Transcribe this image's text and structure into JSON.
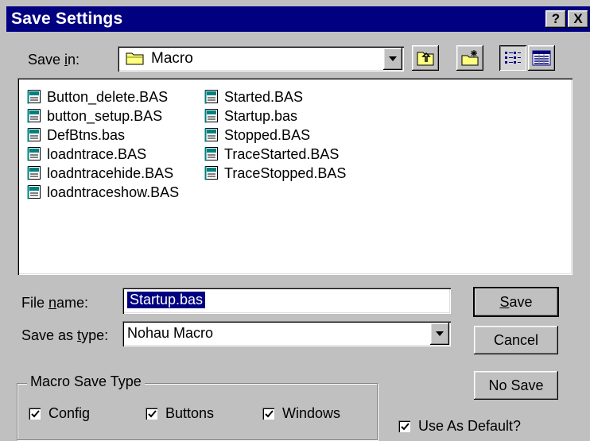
{
  "dialog": {
    "title": "Save Settings",
    "help_glyph": "?",
    "close_glyph": "X"
  },
  "save_in": {
    "label_pre": "Save ",
    "label_key": "i",
    "label_post": "n:",
    "value": "Macro"
  },
  "toolbar": {
    "icons": [
      "up-one-level-icon",
      "create-new-folder-icon",
      "list-view-icon",
      "details-view-icon"
    ]
  },
  "files": {
    "column_1": [
      "Button_delete.BAS",
      "button_setup.BAS",
      "DefBtns.bas",
      "loadntrace.BAS",
      "loadntracehide.BAS",
      "loadntraceshow.BAS"
    ],
    "column_2": [
      "Started.BAS",
      "Startup.bas",
      "Stopped.BAS",
      "TraceStarted.BAS",
      "TraceStopped.BAS"
    ]
  },
  "file_name": {
    "label_pre": "File ",
    "label_key": "n",
    "label_post": "ame:",
    "value": "Startup.bas"
  },
  "save_as_type": {
    "label_pre": "Save as ",
    "label_key": "t",
    "label_post": "ype:",
    "value": "Nohau Macro"
  },
  "buttons": {
    "save_key": "S",
    "save_rest": "ave",
    "cancel": "Cancel",
    "no_save": "No Save"
  },
  "macro_save_type": {
    "legend": "Macro Save Type",
    "options": [
      {
        "label": "Config",
        "checked": true
      },
      {
        "label": "Buttons",
        "checked": true
      },
      {
        "label": "Windows",
        "checked": true
      }
    ]
  },
  "use_as_default": {
    "label": "Use As Default?",
    "checked": true
  },
  "colors": {
    "titlebar": "#000080",
    "face": "#c0c0c0",
    "selection": "#000080"
  }
}
